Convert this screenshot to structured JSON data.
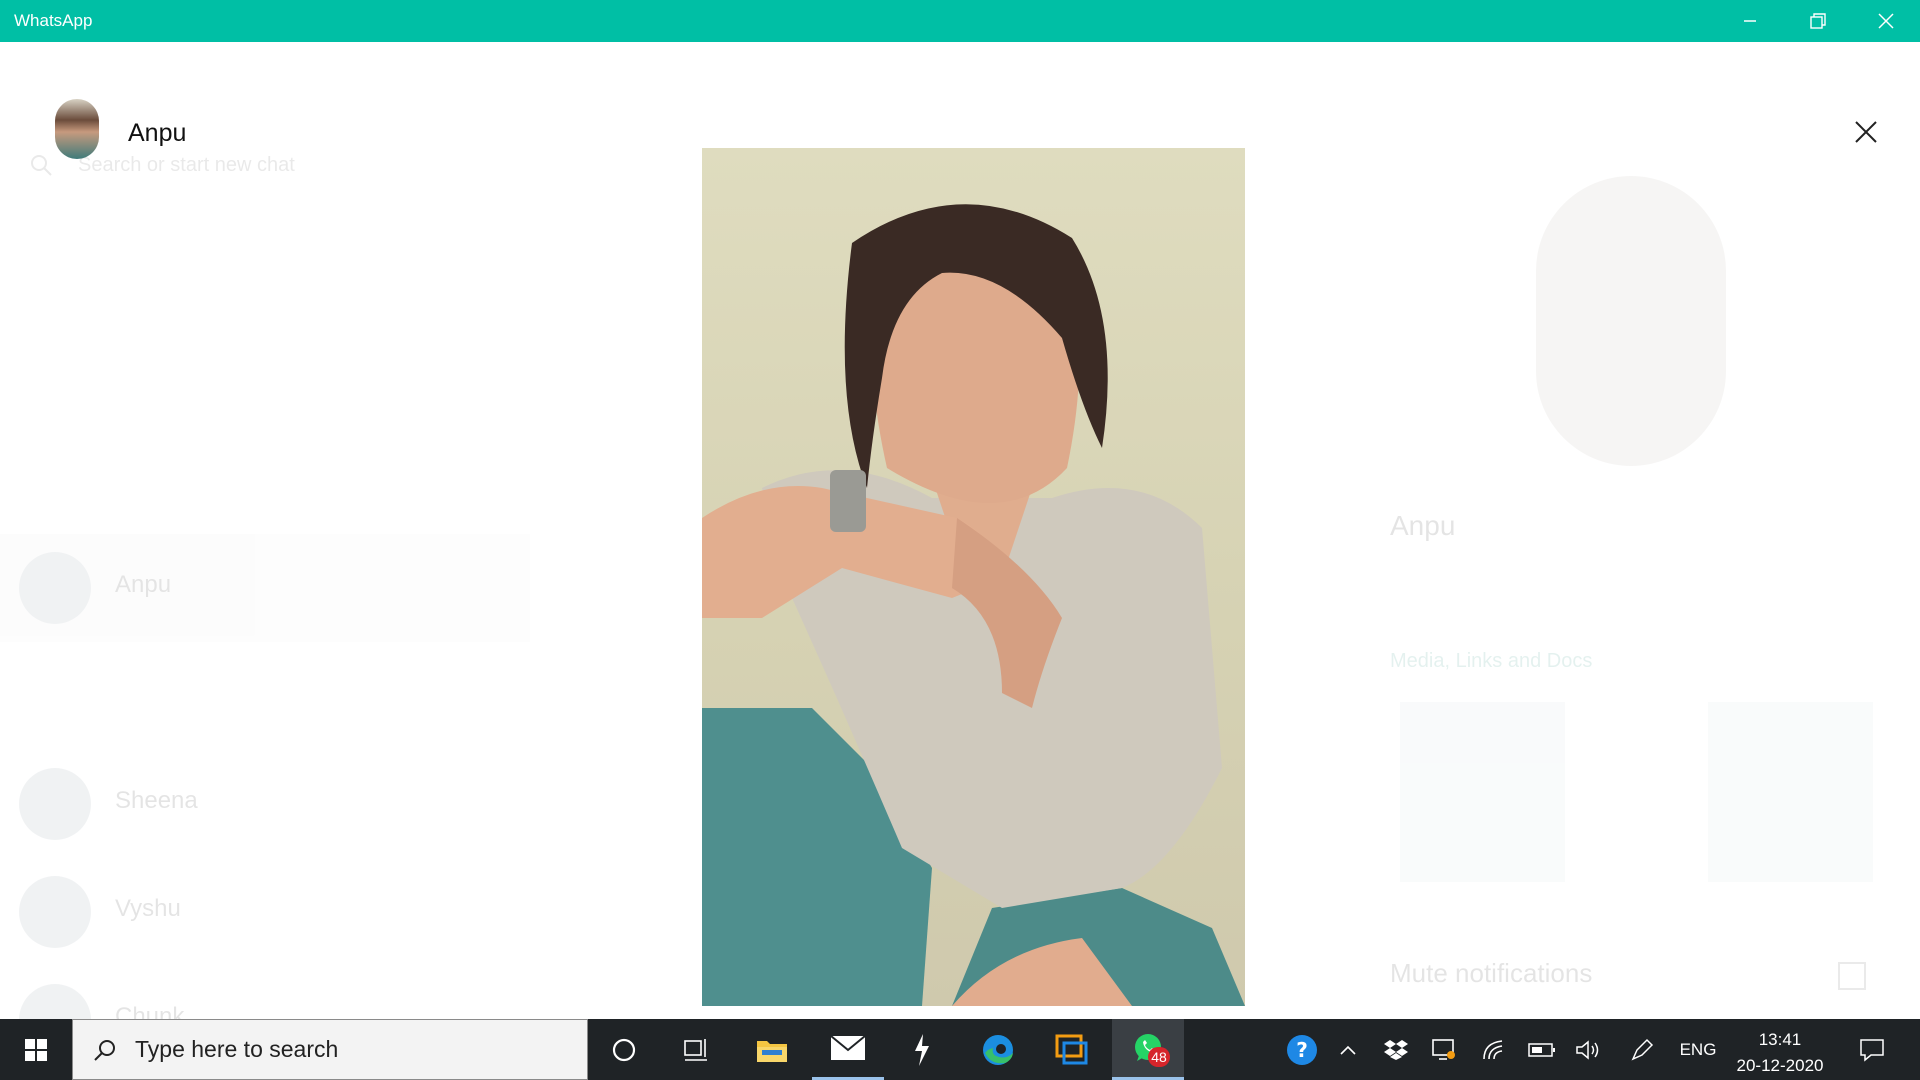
{
  "window": {
    "title": "WhatsApp"
  },
  "viewer": {
    "contact_name": "Anpu"
  },
  "background_app": {
    "search_placeholder": "Search or start new chat",
    "chats": [
      {
        "name": "Anpu",
        "preview": "",
        "time": "",
        "active": true
      },
      {
        "name": "Sheena",
        "preview": "",
        "time": "",
        "active": false
      },
      {
        "name": "Vyshu",
        "preview": "",
        "time": "",
        "active": false
      },
      {
        "name": "Chunk",
        "preview": "",
        "time": "",
        "active": false
      }
    ],
    "profile": {
      "name": "Anpu",
      "status": "",
      "media_label": "Media, Links and Docs",
      "mute_label": "Mute notifications"
    }
  },
  "taskbar": {
    "search_placeholder": "Type here to search",
    "whatsapp_badge": "48",
    "language": "ENG",
    "time": "13:41",
    "date": "20-12-2020"
  },
  "colors": {
    "titlebar": "#00bfa5",
    "taskbar": "#1f2326",
    "badge": "#d6252b"
  }
}
